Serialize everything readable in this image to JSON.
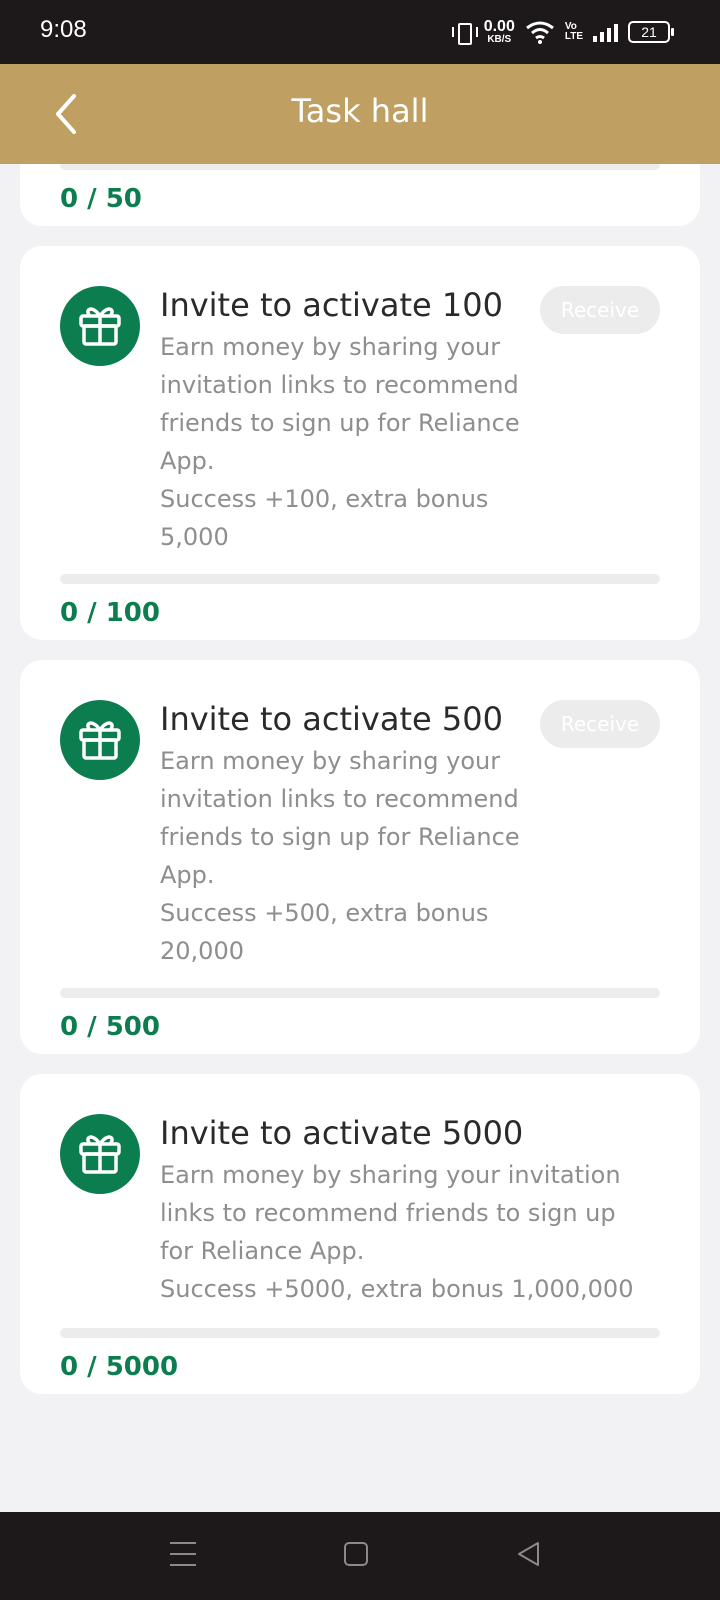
{
  "status_bar": {
    "time": "9:08",
    "net_speed_value": "0.00",
    "net_speed_unit": "KB/S",
    "volte_top": "Vo",
    "volte_bottom": "LTE",
    "battery": "21"
  },
  "header": {
    "title": "Task hall",
    "back_icon": "chevron-left-icon",
    "background": "#bfa062"
  },
  "accent_color": "#0c7d4e",
  "tasks": [
    {
      "title": "",
      "description": [],
      "receive_label": "",
      "progress_current": 0,
      "progress_target": 50,
      "progress_text": "0 / 50"
    },
    {
      "title": "Invite to activate 100",
      "description": [
        "Earn money by sharing your",
        "invitation links to recommend",
        "friends to sign up for Reliance",
        "App.",
        "Success +100, extra bonus",
        "5,000"
      ],
      "receive_label": "Receive",
      "progress_current": 0,
      "progress_target": 100,
      "progress_text": "0 / 100"
    },
    {
      "title": "Invite to activate 500",
      "description": [
        "Earn money by sharing your",
        "invitation links to recommend",
        "friends to sign up for Reliance",
        "App.",
        "Success +500, extra bonus",
        "20,000"
      ],
      "receive_label": "Receive",
      "progress_current": 0,
      "progress_target": 500,
      "progress_text": "0 / 500"
    },
    {
      "title": "Invite to activate 5000",
      "description": [
        "Earn money by sharing your invitation",
        "links to recommend friends to sign up",
        "for Reliance App.",
        "Success +5000, extra bonus 1,000,000"
      ],
      "receive_label": "",
      "progress_current": 0,
      "progress_target": 5000,
      "progress_text": "0 / 5000"
    }
  ],
  "nav_bar": {
    "menu_icon": "menu-icon",
    "home_icon": "square-home-icon",
    "back_icon": "triangle-back-icon"
  }
}
